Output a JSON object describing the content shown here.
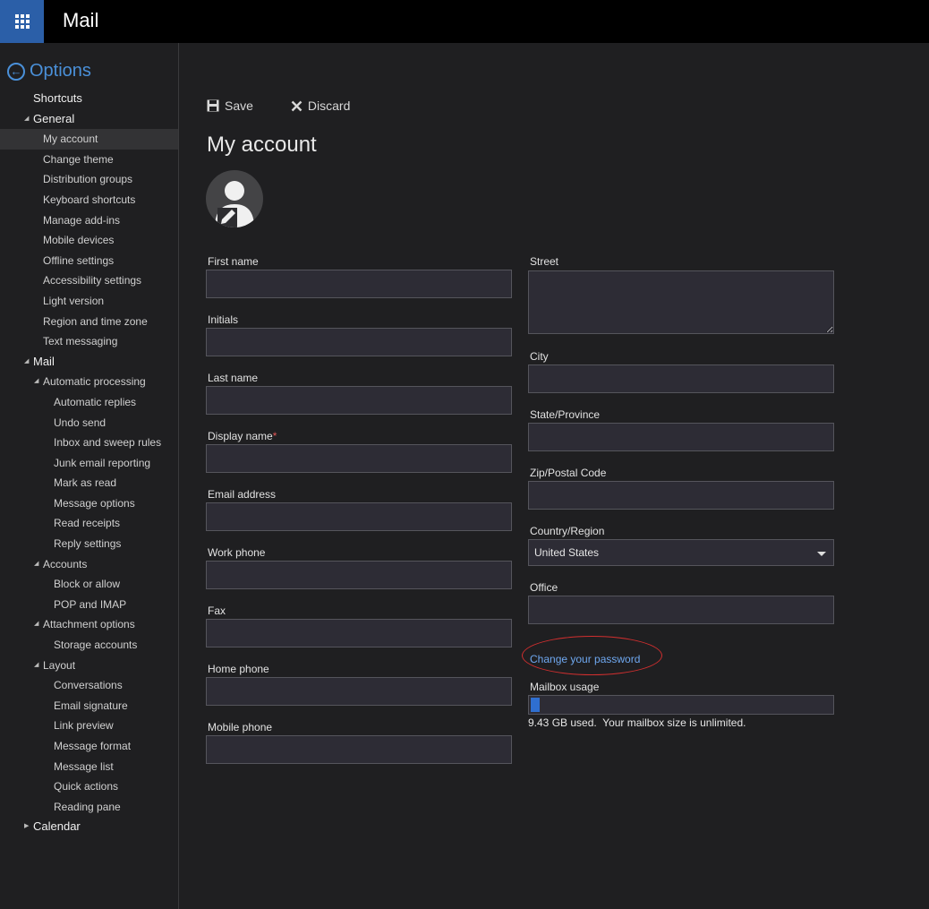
{
  "app": {
    "title": "Mail"
  },
  "sidebar": {
    "options_label": "Options",
    "items": [
      {
        "label": "Shortcuts",
        "level": 0,
        "caret": ""
      },
      {
        "label": "General",
        "level": 0,
        "caret": "expanded"
      },
      {
        "label": "My account",
        "level": 1,
        "caret": "",
        "selected": true
      },
      {
        "label": "Change theme",
        "level": 1,
        "caret": ""
      },
      {
        "label": "Distribution groups",
        "level": 1,
        "caret": ""
      },
      {
        "label": "Keyboard shortcuts",
        "level": 1,
        "caret": ""
      },
      {
        "label": "Manage add-ins",
        "level": 1,
        "caret": ""
      },
      {
        "label": "Mobile devices",
        "level": 1,
        "caret": ""
      },
      {
        "label": "Offline settings",
        "level": 1,
        "caret": ""
      },
      {
        "label": "Accessibility settings",
        "level": 1,
        "caret": ""
      },
      {
        "label": "Light version",
        "level": 1,
        "caret": ""
      },
      {
        "label": "Region and time zone",
        "level": 1,
        "caret": ""
      },
      {
        "label": "Text messaging",
        "level": 1,
        "caret": ""
      },
      {
        "label": "Mail",
        "level": 0,
        "caret": "expanded"
      },
      {
        "label": "Automatic processing",
        "level": 1,
        "caret": "expanded"
      },
      {
        "label": "Automatic replies",
        "level": 2,
        "caret": ""
      },
      {
        "label": "Undo send",
        "level": 2,
        "caret": ""
      },
      {
        "label": "Inbox and sweep rules",
        "level": 2,
        "caret": ""
      },
      {
        "label": "Junk email reporting",
        "level": 2,
        "caret": ""
      },
      {
        "label": "Mark as read",
        "level": 2,
        "caret": ""
      },
      {
        "label": "Message options",
        "level": 2,
        "caret": ""
      },
      {
        "label": "Read receipts",
        "level": 2,
        "caret": ""
      },
      {
        "label": "Reply settings",
        "level": 2,
        "caret": ""
      },
      {
        "label": "Accounts",
        "level": 1,
        "caret": "expanded"
      },
      {
        "label": "Block or allow",
        "level": 2,
        "caret": ""
      },
      {
        "label": "POP and IMAP",
        "level": 2,
        "caret": ""
      },
      {
        "label": "Attachment options",
        "level": 1,
        "caret": "expanded"
      },
      {
        "label": "Storage accounts",
        "level": 2,
        "caret": ""
      },
      {
        "label": "Layout",
        "level": 1,
        "caret": "expanded"
      },
      {
        "label": "Conversations",
        "level": 2,
        "caret": ""
      },
      {
        "label": "Email signature",
        "level": 2,
        "caret": ""
      },
      {
        "label": "Link preview",
        "level": 2,
        "caret": ""
      },
      {
        "label": "Message format",
        "level": 2,
        "caret": ""
      },
      {
        "label": "Message list",
        "level": 2,
        "caret": ""
      },
      {
        "label": "Quick actions",
        "level": 2,
        "caret": ""
      },
      {
        "label": "Reading pane",
        "level": 2,
        "caret": ""
      },
      {
        "label": "Calendar",
        "level": 0,
        "caret": "collapsed"
      }
    ]
  },
  "toolbar": {
    "save_label": "Save",
    "discard_label": "Discard"
  },
  "page": {
    "title": "My account"
  },
  "form": {
    "first_name": {
      "label": "First name",
      "value": ""
    },
    "initials": {
      "label": "Initials",
      "value": ""
    },
    "last_name": {
      "label": "Last name",
      "value": ""
    },
    "display_name": {
      "label": "Display name",
      "required_mark": "*",
      "value": ""
    },
    "email": {
      "label": "Email address",
      "value": ""
    },
    "work_phone": {
      "label": "Work phone",
      "value": ""
    },
    "fax": {
      "label": "Fax",
      "value": ""
    },
    "home_phone": {
      "label": "Home phone",
      "value": ""
    },
    "mobile_phone": {
      "label": "Mobile phone",
      "value": ""
    },
    "street": {
      "label": "Street",
      "value": ""
    },
    "city": {
      "label": "City",
      "value": ""
    },
    "state": {
      "label": "State/Province",
      "value": ""
    },
    "zip": {
      "label": "Zip/Postal Code",
      "value": ""
    },
    "country": {
      "label": "Country/Region",
      "value": "United States"
    },
    "office": {
      "label": "Office",
      "value": ""
    }
  },
  "password": {
    "link_label": "Change your password"
  },
  "mailbox": {
    "label": "Mailbox usage",
    "used_fraction": 0.03,
    "usage_text": "9.43 GB used.  Your mailbox size is unlimited."
  },
  "colors": {
    "accent": "#4a90d9",
    "link": "#6fa8f0",
    "waffle": "#2b5fa8",
    "annotation": "#d22f2f",
    "usage_fill": "#2f6fd0"
  },
  "icons": [
    "app-launcher-icon",
    "back-arrow-icon",
    "save-icon",
    "discard-icon",
    "avatar-person-icon",
    "edit-pencil-icon",
    "dropdown-caret-icon"
  ]
}
